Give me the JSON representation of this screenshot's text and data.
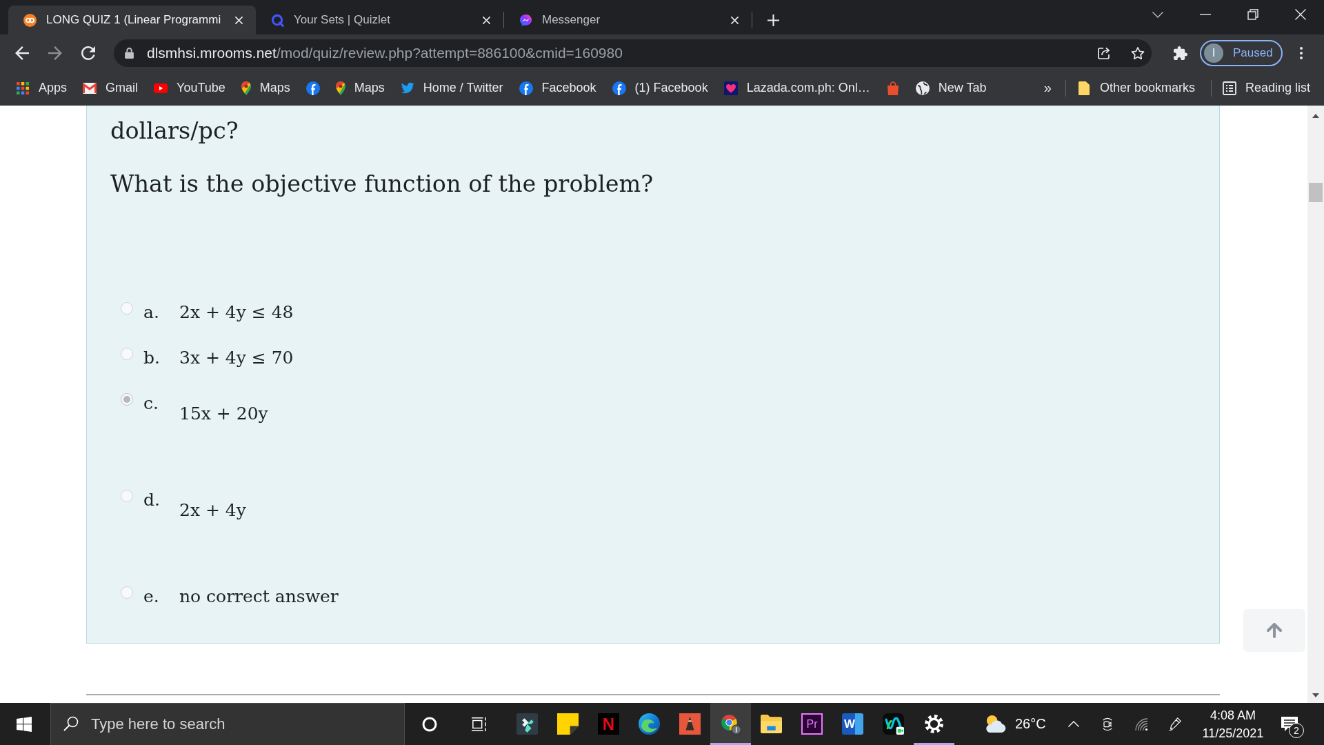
{
  "browser": {
    "tabs": [
      {
        "title": "LONG QUIZ 1 (Linear Programmi",
        "selected": true
      },
      {
        "title": "Your Sets | Quizlet",
        "selected": false
      },
      {
        "title": "Messenger",
        "selected": false
      }
    ],
    "address_bar": {
      "host": "dlsmhsi.mrooms.net",
      "path": "/mod/quiz/review.php?attempt=886100&cmid=160980"
    },
    "profile": {
      "initial": "I",
      "status": "Paused"
    },
    "bookmarks": [
      {
        "kind": "link",
        "label": "Apps"
      },
      {
        "kind": "link",
        "label": "Gmail"
      },
      {
        "kind": "link",
        "label": "YouTube"
      },
      {
        "kind": "link",
        "label": "Maps"
      },
      {
        "kind": "icon"
      },
      {
        "kind": "link",
        "label": "Maps"
      },
      {
        "kind": "link",
        "label": "Home / Twitter"
      },
      {
        "kind": "link",
        "label": "Facebook"
      },
      {
        "kind": "link",
        "label": "(1) Facebook"
      },
      {
        "kind": "link",
        "label": "Lazada.com.ph: Onl…"
      },
      {
        "kind": "icon"
      },
      {
        "kind": "link",
        "label": "New Tab"
      }
    ],
    "bookmarks_overflow": "»",
    "other_bookmarks": "Other bookmarks",
    "reading_list": "Reading list"
  },
  "question": {
    "text": [
      "dollars/pc?",
      "What is the objective function of the problem?"
    ],
    "options": [
      {
        "letter": "a.",
        "answer": "2x + 4y ≤ 48",
        "kind": "inline",
        "selected": false
      },
      {
        "letter": "b.",
        "answer": "3x + 4y ≤ 70",
        "kind": "inline",
        "selected": false
      },
      {
        "letter": "c.",
        "answer": "15x + 20y",
        "kind": "block",
        "selected": true
      },
      {
        "letter": "d.",
        "answer": "2x + 4y",
        "kind": "block",
        "selected": false
      },
      {
        "letter": "e.",
        "answer": "no correct answer",
        "kind": "inline",
        "selected": false
      }
    ]
  },
  "taskbar": {
    "search": {
      "placeholder": "Type here to search"
    },
    "apps": [
      {
        "running": false,
        "active": false
      },
      {
        "running": false,
        "active": false
      },
      {
        "glyph": "N",
        "running": false,
        "active": false
      },
      {
        "running": false,
        "active": false
      },
      {
        "running": false,
        "active": false
      },
      {
        "running": true,
        "active": true
      },
      {
        "running": false,
        "active": false
      },
      {
        "glyph": "Pr",
        "running": false,
        "active": false
      },
      {
        "glyph": "W",
        "running": false,
        "active": false
      },
      {
        "running": false,
        "active": false
      },
      {
        "running": true,
        "active": false
      }
    ],
    "temperature": "26°C",
    "time": "4:08 AM",
    "date": "11/25/2021",
    "notifications": "2"
  }
}
